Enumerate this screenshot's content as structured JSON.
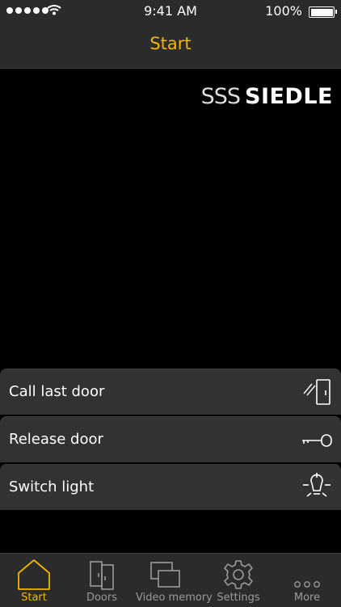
{
  "status_bar": {
    "time": "9:41 AM",
    "battery": "100%"
  },
  "header": {
    "title": "Start"
  },
  "brand": {
    "prefix": "SSS",
    "name": "SIEDLE"
  },
  "actions": [
    {
      "label": "Call last door",
      "icon": "door-call-icon"
    },
    {
      "label": "Release door",
      "icon": "key-icon"
    },
    {
      "label": "Switch light",
      "icon": "light-bulb-icon"
    }
  ],
  "tabs": [
    {
      "label": "Start",
      "icon": "home-icon",
      "active": true
    },
    {
      "label": "Doors",
      "icon": "doors-icon",
      "active": false
    },
    {
      "label": "Video memory",
      "icon": "video-memory-icon",
      "active": false
    },
    {
      "label": "Settings",
      "icon": "gear-icon",
      "active": false
    },
    {
      "label": "More",
      "icon": "more-dots-icon",
      "active": false
    }
  ],
  "colors": {
    "accent": "#f2b400",
    "bar": "#2b2b2b",
    "row": "#323232",
    "inactive": "#9a9a9a"
  }
}
